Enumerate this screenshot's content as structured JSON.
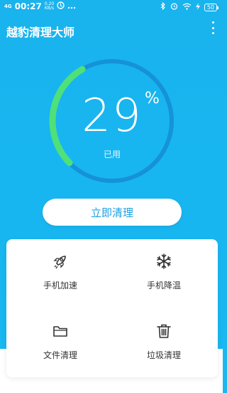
{
  "status_bar": {
    "signal": "4G",
    "time": "00:27",
    "speed_value": "0.20",
    "speed_unit": "KB/s",
    "battery": "50"
  },
  "header": {
    "title": "越豹清理大师"
  },
  "memory": {
    "percent": 29,
    "value_text": "29",
    "unit": "%",
    "label": "已用"
  },
  "clean_button_label": "立即清理",
  "tools": [
    {
      "label": "手机加速",
      "icon": "rocket-icon"
    },
    {
      "label": "手机降温",
      "icon": "snowflake-icon"
    },
    {
      "label": "文件清理",
      "icon": "folder-icon"
    },
    {
      "label": "垃圾清理",
      "icon": "trash-icon"
    }
  ],
  "colors": {
    "background": "#19b3ee",
    "gauge_track": "#1592d8",
    "gauge_progress": "#4fe07a",
    "button_text": "#1a9fe3"
  }
}
